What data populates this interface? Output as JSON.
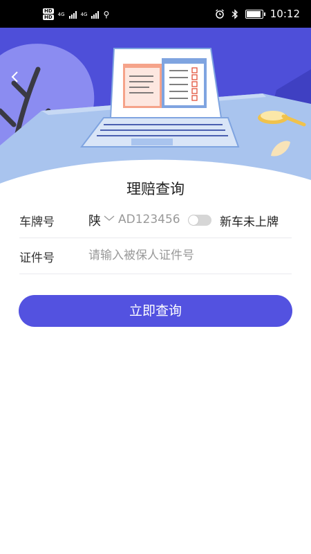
{
  "status_bar": {
    "hd1": "HD",
    "hd2": "HD",
    "net1": "4G",
    "net2": "4G",
    "time": "10:12",
    "icons": [
      "alarm-icon",
      "bluetooth-icon",
      "battery-icon",
      "usb-icon"
    ]
  },
  "header": {
    "back_icon": "chevron-left-icon"
  },
  "page": {
    "title": "理赔查询"
  },
  "form": {
    "plate": {
      "label": "车牌号",
      "province": "陕",
      "placeholder": "AD123456",
      "toggle_label": "新车未上牌",
      "toggle_on": false
    },
    "id": {
      "label": "证件号",
      "placeholder": "请输入被保人证件号"
    }
  },
  "actions": {
    "query_label": "立即查询"
  },
  "colors": {
    "primary": "#5352e0",
    "hero_bg": "#4e4fd9",
    "desk": "#a9c4ee"
  }
}
